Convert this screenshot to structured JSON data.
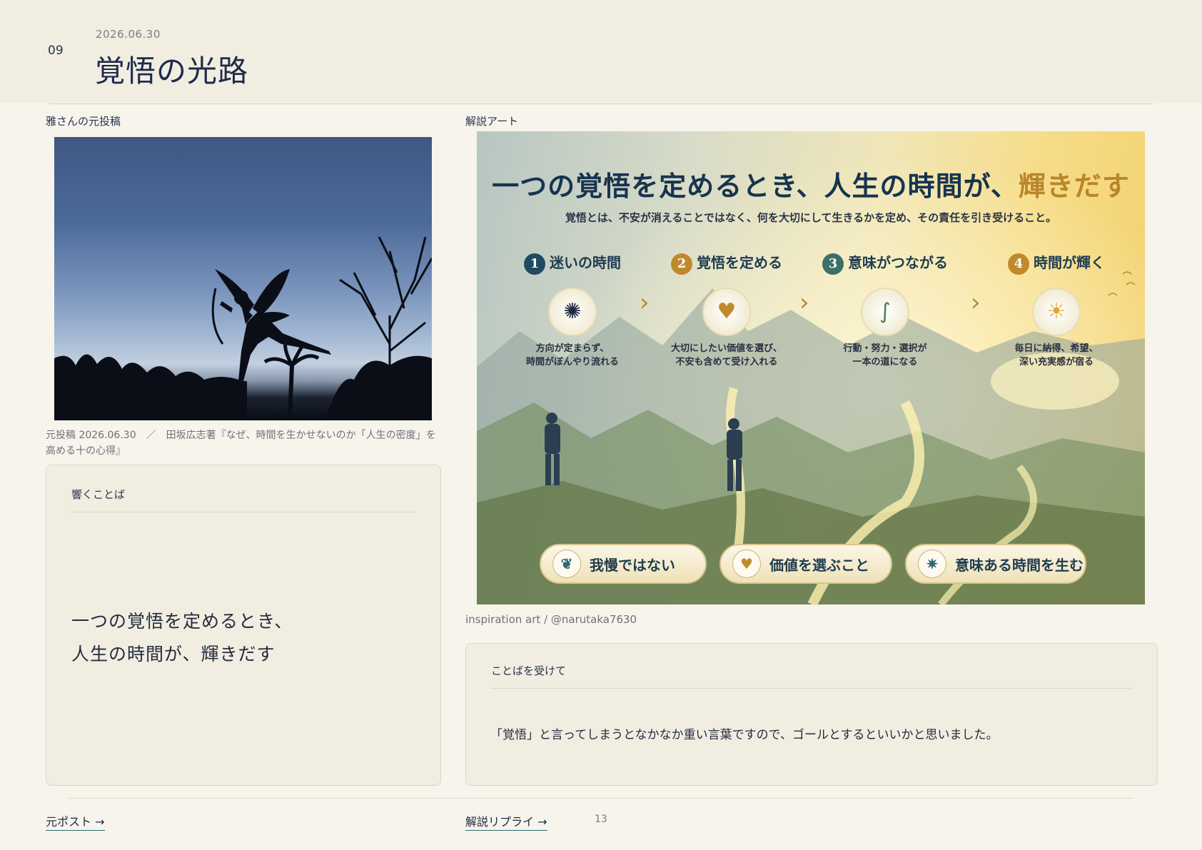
{
  "header": {
    "number": "09",
    "date": "2026.06.30",
    "title": "覚悟の光路"
  },
  "left": {
    "section_label": "雅さんの元投稿",
    "caption": "元投稿 2026.06.30　／　田坂広志著『なぜ、時間を生かせないのか「人生の密度」を高める十の心得』",
    "card": {
      "heading": "響くことば",
      "quote_line1": "一つの覚悟を定めるとき、",
      "quote_line2": "人生の時間が、輝きだす"
    }
  },
  "right": {
    "section_label": "解説アート",
    "art": {
      "title_parts": [
        "一つの",
        "覚悟",
        "を定めるとき、",
        "人生",
        "の",
        "時間",
        "が、",
        "輝きだす"
      ],
      "subtitle": "覚悟とは、不安が消えることではなく、何を大切にして生きるかを定め、その責任を引き受けること。",
      "steps": [
        {
          "num": "1",
          "label": "迷いの時間",
          "icon": "tangled-knot-icon",
          "desc1": "方向が定まらず、",
          "desc2": "時間がぼんやり流れる",
          "color": "#1f4a5f"
        },
        {
          "num": "2",
          "label": "覚悟を定める",
          "icon": "heart-in-hand-icon",
          "desc1": "大切にしたい価値を選び、",
          "desc2": "不安も含めて受け入れる",
          "color": "#c08a2a"
        },
        {
          "num": "3",
          "label": "意味がつながる",
          "icon": "winding-path-icon",
          "desc1": "行動・努力・選択が",
          "desc2": "一本の道になる",
          "color": "#3c6f68"
        },
        {
          "num": "4",
          "label": "時間が輝く",
          "icon": "sun-icon",
          "desc1": "毎日に納得、希望、",
          "desc2": "深い充実感が宿る",
          "color": "#c08a2a"
        }
      ],
      "pills": [
        {
          "label": "我慢ではない",
          "icon": "leaf-sprout-icon"
        },
        {
          "label": "価値を選ぶこと",
          "icon": "heart-icon"
        },
        {
          "label": "意味ある時間を生む",
          "icon": "star-burst-icon"
        }
      ]
    },
    "art_credit": "inspiration art / @narutaka7630",
    "card": {
      "heading": "ことばを受けて",
      "response": "「覚悟」と言ってしまうとなかなか重い言葉ですので、ゴールとするといいかと思いました。"
    }
  },
  "footer": {
    "original_post_link": "元ポスト →",
    "explanation_link": "解説リプライ →",
    "count": "13"
  },
  "colors": {
    "background": "#f7f4ec",
    "header_bg": "#f1ede1",
    "card_bg": "#f1ede1",
    "accent_teal": "#2d6a70",
    "accent_gold": "#b9862b",
    "text_navy": "#1d2a4a"
  }
}
